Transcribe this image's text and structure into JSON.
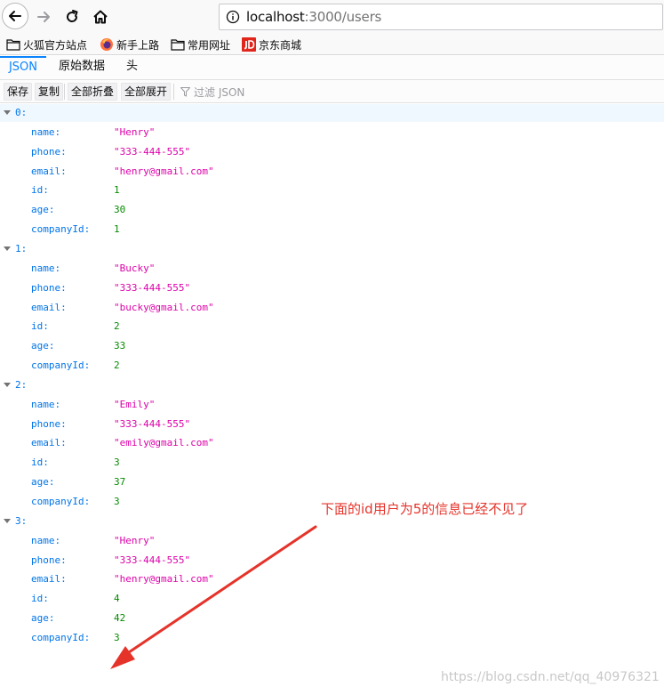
{
  "browser": {
    "url_host": "localhost",
    "url_rest": ":3000/users"
  },
  "bookmarks": [
    {
      "label": "火狐官方站点",
      "icon": "folder-icon"
    },
    {
      "label": "新手上路",
      "icon": "firefox-icon"
    },
    {
      "label": "常用网址",
      "icon": "folder-icon"
    },
    {
      "label": "京东商城",
      "icon": "jd-icon"
    }
  ],
  "viewer": {
    "tabs": [
      "JSON",
      "原始数据",
      "头"
    ],
    "active_tab": "JSON",
    "toolbar": {
      "save": "保存",
      "copy": "复制",
      "collapse_all": "全部折叠",
      "expand_all": "全部展开",
      "filter_placeholder": "过滤 JSON"
    }
  },
  "users": [
    {
      "index": "0:",
      "fields": [
        {
          "key": "name:",
          "value": "\"Henry\"",
          "type": "string"
        },
        {
          "key": "phone:",
          "value": "\"333-444-555\"",
          "type": "string"
        },
        {
          "key": "email:",
          "value": "\"henry@gmail.com\"",
          "type": "string"
        },
        {
          "key": "id:",
          "value": "1",
          "type": "number"
        },
        {
          "key": "age:",
          "value": "30",
          "type": "number"
        },
        {
          "key": "companyId:",
          "value": "1",
          "type": "number"
        }
      ]
    },
    {
      "index": "1:",
      "fields": [
        {
          "key": "name:",
          "value": "\"Bucky\"",
          "type": "string"
        },
        {
          "key": "phone:",
          "value": "\"333-444-555\"",
          "type": "string"
        },
        {
          "key": "email:",
          "value": "\"bucky@gmail.com\"",
          "type": "string"
        },
        {
          "key": "id:",
          "value": "2",
          "type": "number"
        },
        {
          "key": "age:",
          "value": "33",
          "type": "number"
        },
        {
          "key": "companyId:",
          "value": "2",
          "type": "number"
        }
      ]
    },
    {
      "index": "2:",
      "fields": [
        {
          "key": "name:",
          "value": "\"Emily\"",
          "type": "string"
        },
        {
          "key": "phone:",
          "value": "\"333-444-555\"",
          "type": "string"
        },
        {
          "key": "email:",
          "value": "\"emily@gmail.com\"",
          "type": "string"
        },
        {
          "key": "id:",
          "value": "3",
          "type": "number"
        },
        {
          "key": "age:",
          "value": "37",
          "type": "number"
        },
        {
          "key": "companyId:",
          "value": "3",
          "type": "number"
        }
      ]
    },
    {
      "index": "3:",
      "fields": [
        {
          "key": "name:",
          "value": "\"Henry\"",
          "type": "string"
        },
        {
          "key": "phone:",
          "value": "\"333-444-555\"",
          "type": "string"
        },
        {
          "key": "email:",
          "value": "\"henry@gmail.com\"",
          "type": "string"
        },
        {
          "key": "id:",
          "value": "4",
          "type": "number"
        },
        {
          "key": "age:",
          "value": "42",
          "type": "number"
        },
        {
          "key": "companyId:",
          "value": "3",
          "type": "number"
        }
      ]
    }
  ],
  "annotation": "下面的id用户为5的信息已经不见了",
  "watermark": "https://blog.csdn.net/qq_40976321",
  "colors": {
    "key": "#0074e8",
    "string": "#dd00a9",
    "number": "#058b00",
    "annotation": "#e5332a",
    "active_tab": "#0a84ff"
  }
}
